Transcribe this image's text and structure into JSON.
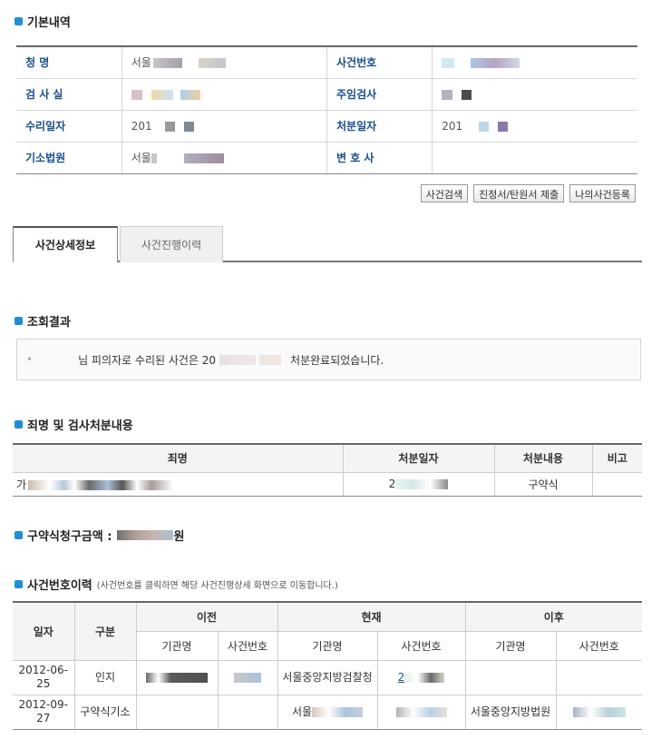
{
  "colors": {
    "accent": "#1e8fd6",
    "label": "#1a4f8c"
  },
  "basic": {
    "title": "기본내역",
    "rows": [
      {
        "l1": "청      명",
        "v1": "서울",
        "l2": "사건번호",
        "v2": ""
      },
      {
        "l1": "검 사 실",
        "v1": "",
        "l2": "주임검사",
        "v2": ""
      },
      {
        "l1": "수리일자",
        "v1": "201",
        "l2": "처분일자",
        "v2": "201"
      },
      {
        "l1": "기소법원",
        "v1": "서울",
        "l2": "변 호 사",
        "v2": ""
      }
    ]
  },
  "buttons": {
    "search": "사건검색",
    "petition": "진정서/탄원서 제출",
    "register": "나의사건등록"
  },
  "tabs": {
    "detail": "사건상세정보",
    "history": "사건진행이력"
  },
  "result": {
    "title": "조회결과",
    "message_a": "님 피의자로 수리된 사건은 20",
    "message_b": "처분완료되었습니다."
  },
  "charges": {
    "title": "죄명 및 검사처분내용",
    "headers": [
      "죄명",
      "처분일자",
      "처분내용",
      "비고"
    ],
    "row": {
      "name": "가",
      "date": "2",
      "disposition": "구약식",
      "note": ""
    }
  },
  "fine": {
    "label": "구약식청구금액 :",
    "unit": "원"
  },
  "history": {
    "title": "사건번호이력",
    "note": "(사건번호를 클릭하면 해당 사건진행상세 화면으로 이동합니다.)",
    "headers": {
      "date": "일자",
      "type": "구분",
      "prev": "이전",
      "cur": "현재",
      "next": "이후",
      "agency": "기관명",
      "caseno": "사건번호"
    },
    "rows": [
      {
        "date": "2012-06-25",
        "type": "인지",
        "prev_agency": "",
        "prev_case": "",
        "cur_agency": "서울중앙지방검찰청",
        "cur_case": "2",
        "next_agency": "",
        "next_case": ""
      },
      {
        "date": "2012-09-27",
        "type": "구약식기소",
        "prev_agency": "",
        "prev_case": "",
        "cur_agency": "서울",
        "cur_case": "",
        "next_agency": "서울중앙지방법원",
        "next_case": ""
      }
    ]
  }
}
